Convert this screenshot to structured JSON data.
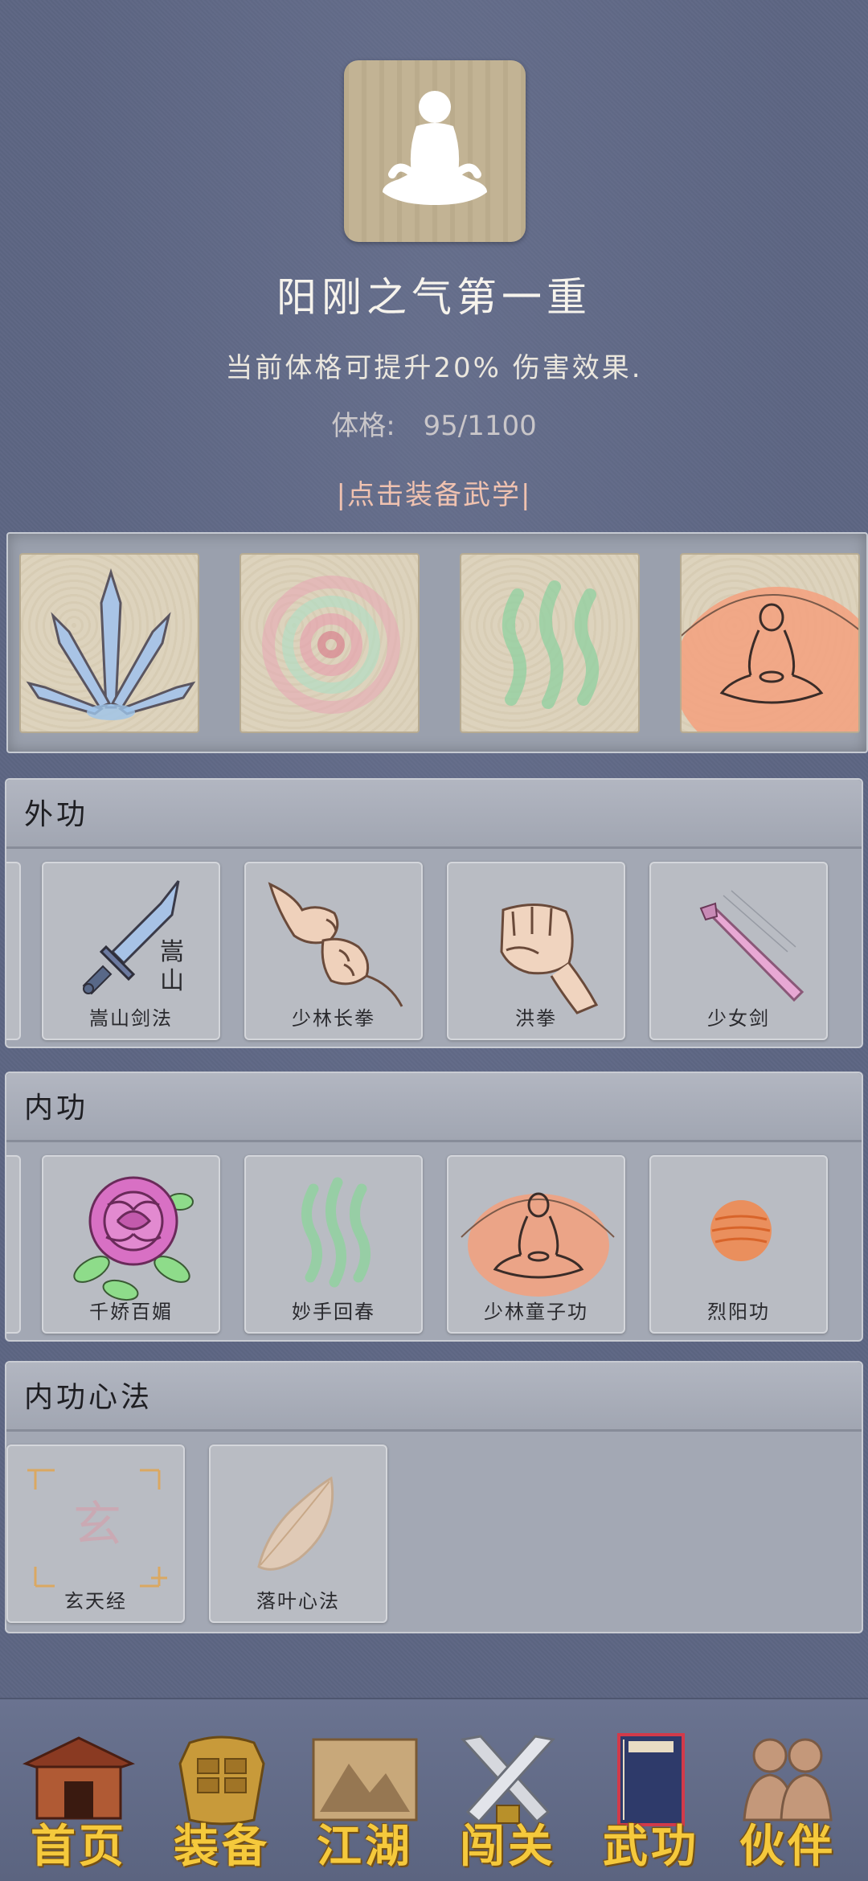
{
  "realm": {
    "title": "阳刚之气第一重",
    "description": "当前体格可提升20% 伤害效果.",
    "stat_label": "体格:",
    "stat_value": "95/1100",
    "equip_hint": "|点击装备武学|",
    "avatar_icon": "meditation-silhouette-icon",
    "equipped_icons": [
      "crystal-swords-icon",
      "pink-spiral-icon",
      "green-waves-icon",
      "meditating-monk-icon"
    ]
  },
  "sections": {
    "waigong": {
      "title": "外功",
      "items": [
        {
          "label": "嵩山剑法",
          "icon": "songshan-sword-icon",
          "glyph": "嵩山"
        },
        {
          "label": "少林长拳",
          "icon": "fists-icon"
        },
        {
          "label": "洪拳",
          "icon": "fist-icon"
        },
        {
          "label": "少女剑",
          "icon": "pink-sword-icon"
        }
      ]
    },
    "neigong": {
      "title": "内功",
      "items": [
        {
          "label": "千娇百媚",
          "icon": "rose-icon"
        },
        {
          "label": "妙手回春",
          "icon": "green-waves-icon"
        },
        {
          "label": "少林童子功",
          "icon": "meditating-monk-icon"
        },
        {
          "label": "烈阳功",
          "icon": "sun-orb-icon"
        }
      ]
    },
    "xinfa": {
      "title": "内功心法",
      "items": [
        {
          "label": "玄天经",
          "icon": "xuan-scroll-icon",
          "glyph": "玄"
        },
        {
          "label": "落叶心法",
          "icon": "leaf-icon"
        }
      ]
    }
  },
  "nav": {
    "items": [
      {
        "label": "首页",
        "icon": "pavilion-icon"
      },
      {
        "label": "装备",
        "icon": "armor-icon"
      },
      {
        "label": "江湖",
        "icon": "mountain-scroll-icon"
      },
      {
        "label": "闯关",
        "icon": "crossed-swords-icon"
      },
      {
        "label": "武功",
        "icon": "martial-book-icon"
      },
      {
        "label": "伙伴",
        "icon": "companions-icon"
      }
    ]
  },
  "colors": {
    "background": "#5d6683",
    "nav_label": "#f5c93c",
    "equip_hint": "#f0c2b0"
  }
}
